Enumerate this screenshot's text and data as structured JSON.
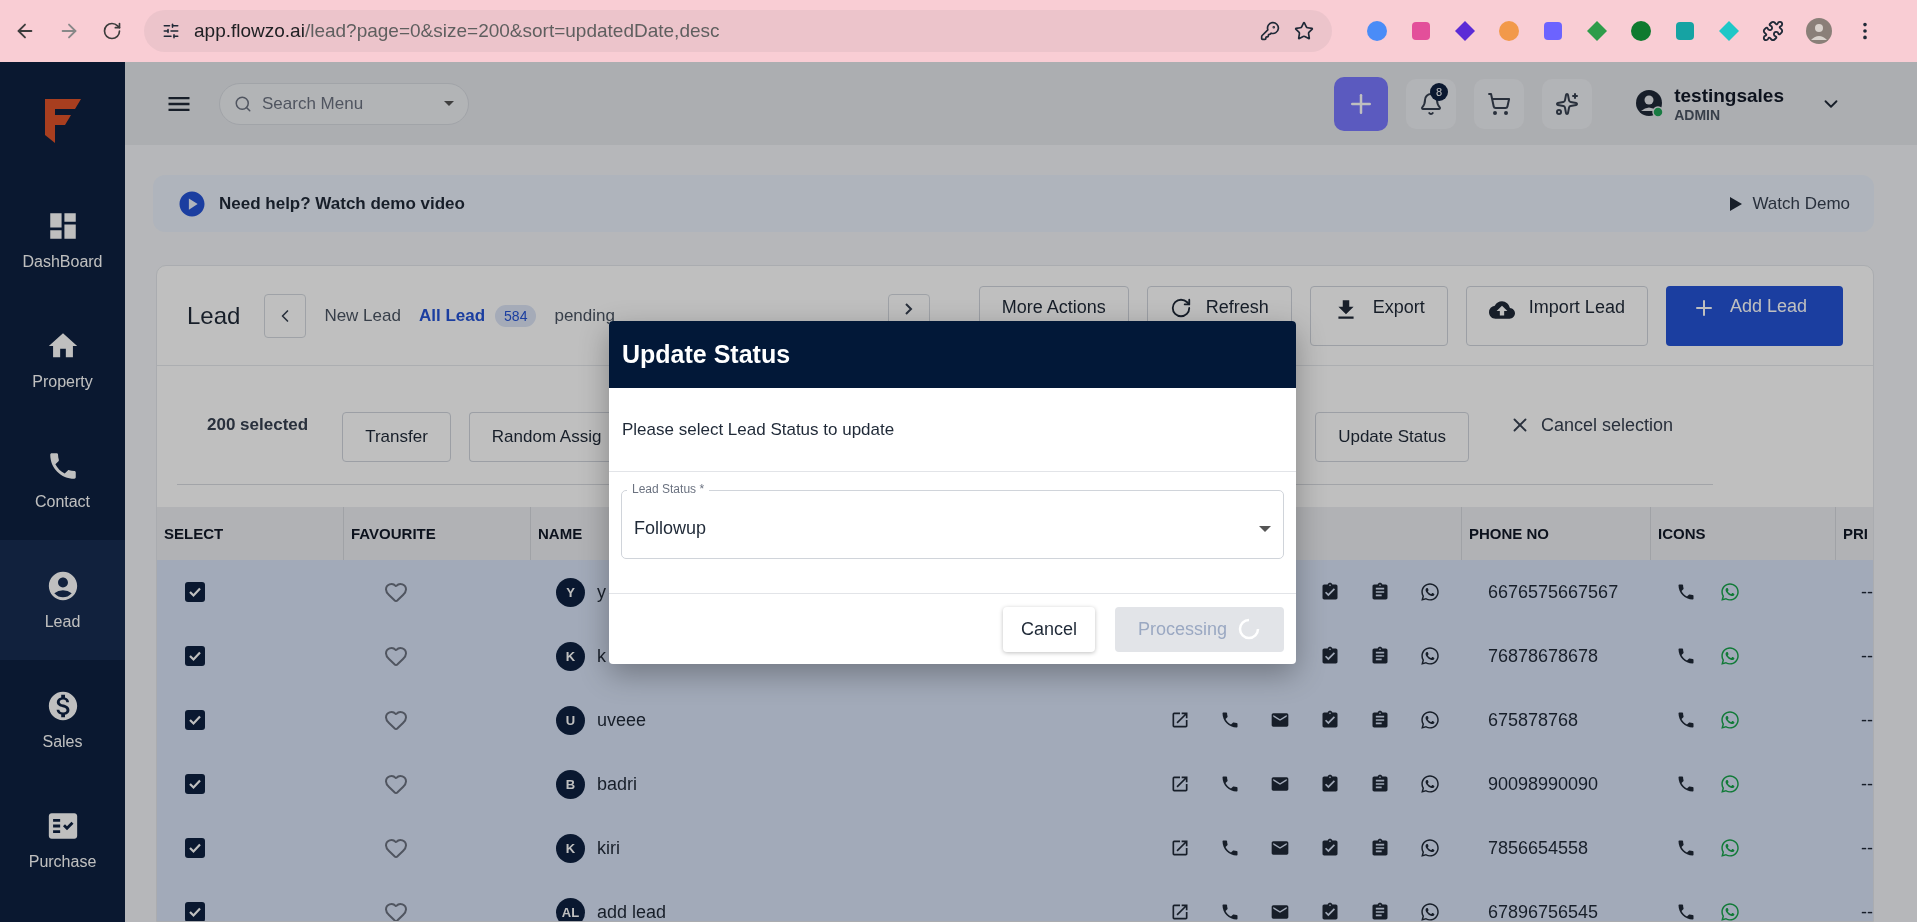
{
  "browser": {
    "url_host": "app.flowzo.ai",
    "url_path": "/lead?page=0&size=200&sort=updatedDate,desc"
  },
  "header": {
    "search_placeholder": "Search Menu",
    "notification_count": "8",
    "user": {
      "name": "testingsales",
      "role": "ADMIN"
    }
  },
  "sidebar": {
    "items": [
      {
        "label": "DashBoard",
        "selected": false
      },
      {
        "label": "Property",
        "selected": false
      },
      {
        "label": "Contact",
        "selected": false
      },
      {
        "label": "Lead",
        "selected": true
      },
      {
        "label": "Sales",
        "selected": false
      },
      {
        "label": "Purchase",
        "selected": false
      }
    ]
  },
  "help_banner": {
    "text": "Need help? Watch demo video",
    "link": "Watch Demo"
  },
  "lead_panel": {
    "title": "Lead",
    "tabs": [
      {
        "label": "New Lead",
        "selected": false
      },
      {
        "label": "All Lead",
        "selected": true,
        "count": "584"
      },
      {
        "label": "pending",
        "selected": false
      }
    ],
    "actions": [
      {
        "label": "More Actions",
        "kind": "plain"
      },
      {
        "label": "Refresh",
        "kind": "refresh"
      },
      {
        "label": "Export",
        "kind": "export"
      },
      {
        "label": "Import Lead",
        "kind": "import"
      },
      {
        "label": "Add Lead",
        "kind": "primary"
      }
    ]
  },
  "selection_bar": {
    "count": "200 selected",
    "actions": [
      "Transfer",
      "Random Assig"
    ],
    "update_button": "Update Status",
    "cancel": "Cancel selection"
  },
  "table": {
    "columns": [
      {
        "label": "SELECT"
      },
      {
        "label": "FAVOURITE"
      },
      {
        "label": "NAME"
      },
      {
        "label": "PHONE NO"
      },
      {
        "label": "ICONS"
      },
      {
        "label": "PRI"
      }
    ],
    "rows": [
      {
        "selected": true,
        "favourite": false,
        "initials": "Y",
        "name": "y",
        "phone": "6676575667567",
        "price": "--",
        "covered": true
      },
      {
        "selected": true,
        "favourite": false,
        "initials": "K",
        "name": "k",
        "phone": "76878678678",
        "price": "--",
        "covered": true
      },
      {
        "selected": true,
        "favourite": false,
        "initials": "U",
        "name": "uveee",
        "phone": "675878768",
        "price": "--",
        "covered": false
      },
      {
        "selected": true,
        "favourite": false,
        "initials": "B",
        "name": "badri",
        "phone": "90098990090",
        "price": "--",
        "covered": false
      },
      {
        "selected": true,
        "favourite": false,
        "initials": "K",
        "name": "kiri",
        "phone": "7856654558",
        "price": "--",
        "covered": false
      },
      {
        "selected": true,
        "favourite": false,
        "initials": "AL",
        "name": "add lead",
        "phone": "67896756545",
        "price": "--",
        "covered": false
      }
    ]
  },
  "dialog": {
    "title": "Update Status",
    "message": "Please select Lead Status to update",
    "field": {
      "label": "Lead Status *",
      "value": "Followup"
    },
    "buttons": [
      {
        "label": "Cancel",
        "kind": "secondary",
        "disabled": false,
        "loading": false
      },
      {
        "label": "Processing",
        "kind": "primary",
        "disabled": true,
        "loading": true
      }
    ]
  }
}
